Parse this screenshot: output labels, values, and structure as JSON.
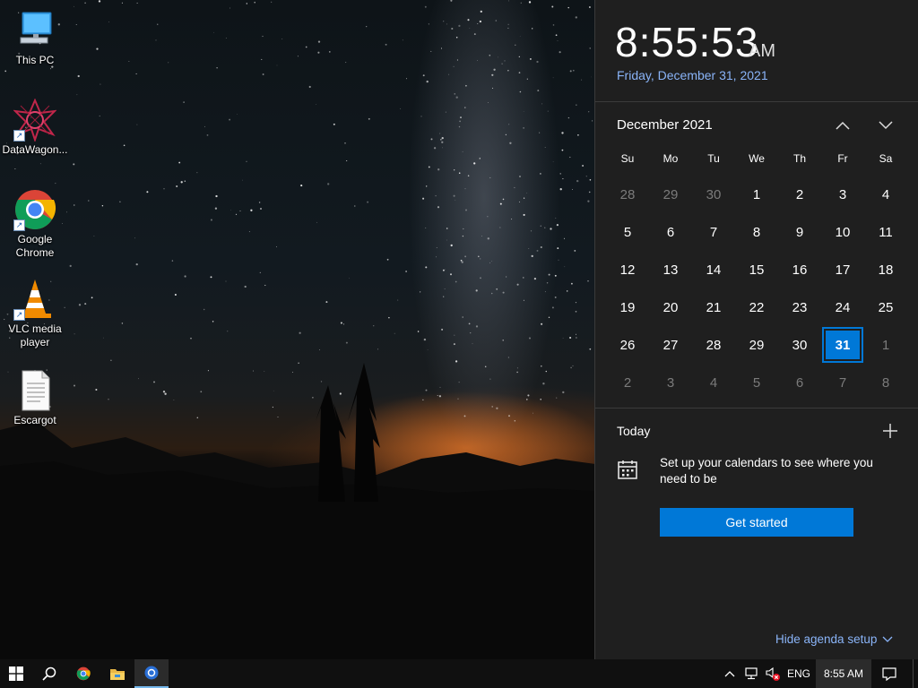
{
  "desktop": {
    "icons": [
      {
        "label": "This PC"
      },
      {
        "label": "DataWagon..."
      },
      {
        "label": "Google Chrome"
      },
      {
        "label": "VLC media player"
      },
      {
        "label": "Escargot"
      }
    ]
  },
  "flyout": {
    "time": "8:55:53",
    "ampm": "AM",
    "date": "Friday, December 31, 2021",
    "month_title": "December 2021",
    "weekdays": [
      "Su",
      "Mo",
      "Tu",
      "We",
      "Th",
      "Fr",
      "Sa"
    ],
    "days": [
      {
        "n": "28",
        "other": true
      },
      {
        "n": "29",
        "other": true
      },
      {
        "n": "30",
        "other": true
      },
      {
        "n": "1"
      },
      {
        "n": "2"
      },
      {
        "n": "3"
      },
      {
        "n": "4"
      },
      {
        "n": "5"
      },
      {
        "n": "6"
      },
      {
        "n": "7"
      },
      {
        "n": "8"
      },
      {
        "n": "9"
      },
      {
        "n": "10"
      },
      {
        "n": "11"
      },
      {
        "n": "12"
      },
      {
        "n": "13"
      },
      {
        "n": "14"
      },
      {
        "n": "15"
      },
      {
        "n": "16"
      },
      {
        "n": "17"
      },
      {
        "n": "18"
      },
      {
        "n": "19"
      },
      {
        "n": "20"
      },
      {
        "n": "21"
      },
      {
        "n": "22"
      },
      {
        "n": "23"
      },
      {
        "n": "24"
      },
      {
        "n": "25"
      },
      {
        "n": "26"
      },
      {
        "n": "27"
      },
      {
        "n": "28"
      },
      {
        "n": "29"
      },
      {
        "n": "30"
      },
      {
        "n": "31",
        "today": true
      },
      {
        "n": "1",
        "other": true
      },
      {
        "n": "2",
        "other": true
      },
      {
        "n": "3",
        "other": true
      },
      {
        "n": "4",
        "other": true
      },
      {
        "n": "5",
        "other": true
      },
      {
        "n": "6",
        "other": true
      },
      {
        "n": "7",
        "other": true
      },
      {
        "n": "8",
        "other": true
      }
    ],
    "agenda": {
      "title": "Today",
      "message": "Set up your calendars to see where you need to be",
      "button": "Get started",
      "hide_link": "Hide agenda setup"
    }
  },
  "taskbar": {
    "language": "ENG",
    "clock": "8:55 AM"
  },
  "colors": {
    "accent": "#0078d7",
    "link": "#8ab4f8",
    "flyout_bg": "#1f1f1f"
  }
}
